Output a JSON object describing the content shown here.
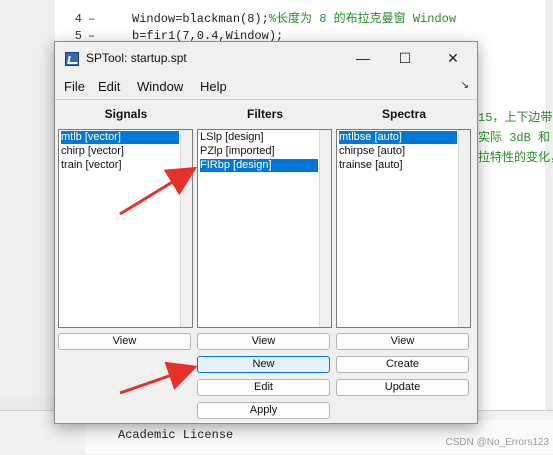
{
  "background": {
    "code_lines": [
      {
        "num": "",
        "dash": "",
        "text": ""
      },
      {
        "num": "4",
        "dash": "–",
        "code": "Window=blackman(8);",
        "comment": "%长度为 8 的布拉克曼窗 Window"
      },
      {
        "num": "5",
        "dash": "–",
        "code": "b=fir1(7,0.4,Window);",
        "comment": ""
      }
    ],
    "side_texts": [
      "15，上下边带",
      "实际 3dB 和",
      "拉特性的变化，"
    ],
    "license": "Academic License",
    "watermark": "CSDN @No_Errors123"
  },
  "window": {
    "title": "SPTool: startup.spt",
    "controls": {
      "minimize": "—",
      "maximize": "☐",
      "close": "✕"
    },
    "menu": [
      "File",
      "Edit",
      "Window",
      "Help"
    ],
    "menu_arrow": "↘"
  },
  "columns": {
    "signals": {
      "title": "Signals",
      "items": [
        "mtlb [vector]",
        "chirp [vector]",
        "train [vector]"
      ],
      "selected": 0,
      "buttons": [
        "View"
      ]
    },
    "filters": {
      "title": "Filters",
      "items": [
        "LSlp [design]",
        "PZlp [imported]",
        "FIRbp [design]"
      ],
      "selected": 2,
      "buttons": [
        "View",
        "New",
        "Edit",
        "Apply"
      ]
    },
    "spectra": {
      "title": "Spectra",
      "items": [
        "mtlbse [auto]",
        "chirpse [auto]",
        "trainse [auto]"
      ],
      "selected": 0,
      "buttons": [
        "View",
        "Create",
        "Update"
      ]
    }
  },
  "annotation_color": "#e8302a",
  "selection_color": "#0078d7"
}
